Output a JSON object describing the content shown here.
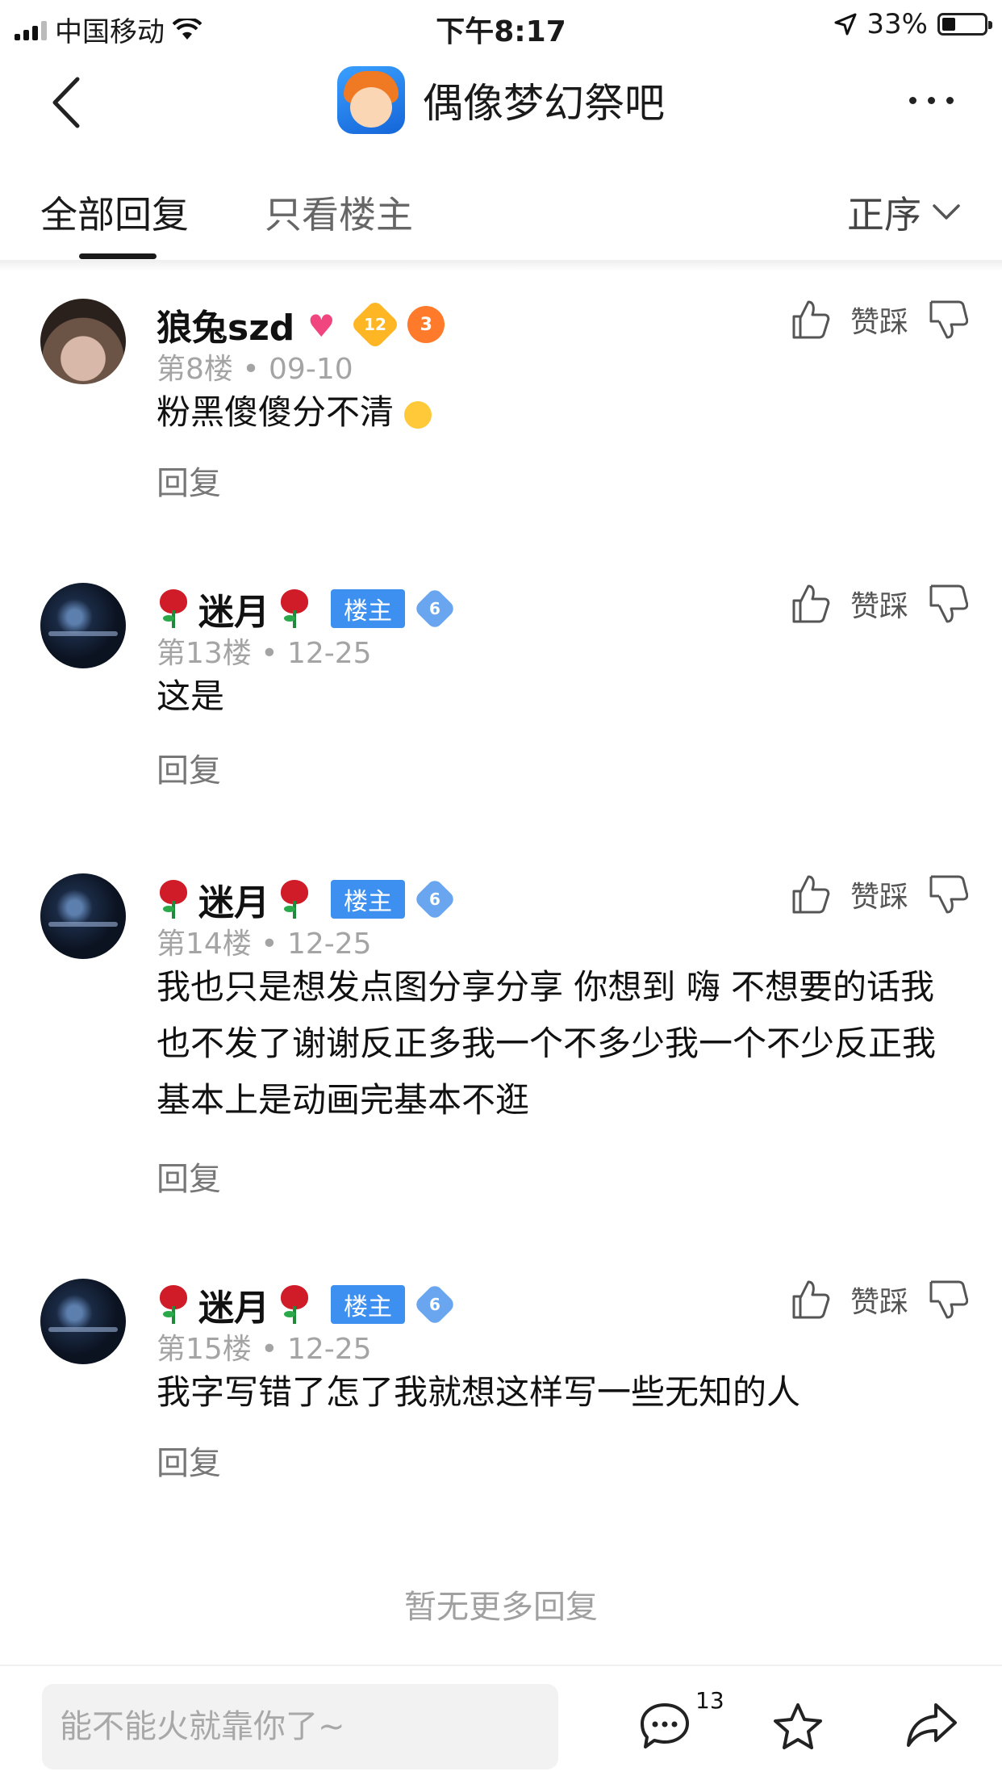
{
  "status_bar": {
    "carrier": "中国移动",
    "time": "下午8:17",
    "battery": "33%"
  },
  "nav": {
    "title": "偶像梦幻祭吧"
  },
  "tabs": {
    "all": "全部回复",
    "owner_only": "只看楼主",
    "sort": "正序"
  },
  "posts": [
    {
      "username": "狼兔szd",
      "level": "12",
      "medal": "3",
      "floor": "第8楼",
      "date": "09-10",
      "content": "粉黑傻傻分不清",
      "reply": "回复",
      "vote_label": "赞踩"
    },
    {
      "username": "迷月",
      "owner_badge": "楼主",
      "level": "6",
      "floor": "第13楼",
      "date": "12-25",
      "content": "这是",
      "reply": "回复",
      "vote_label": "赞踩"
    },
    {
      "username": "迷月",
      "owner_badge": "楼主",
      "level": "6",
      "floor": "第14楼",
      "date": "12-25",
      "content": "我也只是想发点图分享分享 你想到 嗨 不想要的话我也不发了谢谢反正多我一个不多少我一个不少反正我基本上是动画完基本不逛",
      "reply": "回复",
      "vote_label": "赞踩"
    },
    {
      "username": "迷月",
      "owner_badge": "楼主",
      "level": "6",
      "floor": "第15楼",
      "date": "12-25",
      "content": "我字写错了怎了我就想这样写一些无知的人",
      "reply": "回复",
      "vote_label": "赞踩"
    }
  ],
  "footer": {
    "no_more": "暂无更多回复"
  },
  "bottom_bar": {
    "placeholder": "能不能火就靠你了~",
    "comment_count": "13"
  }
}
